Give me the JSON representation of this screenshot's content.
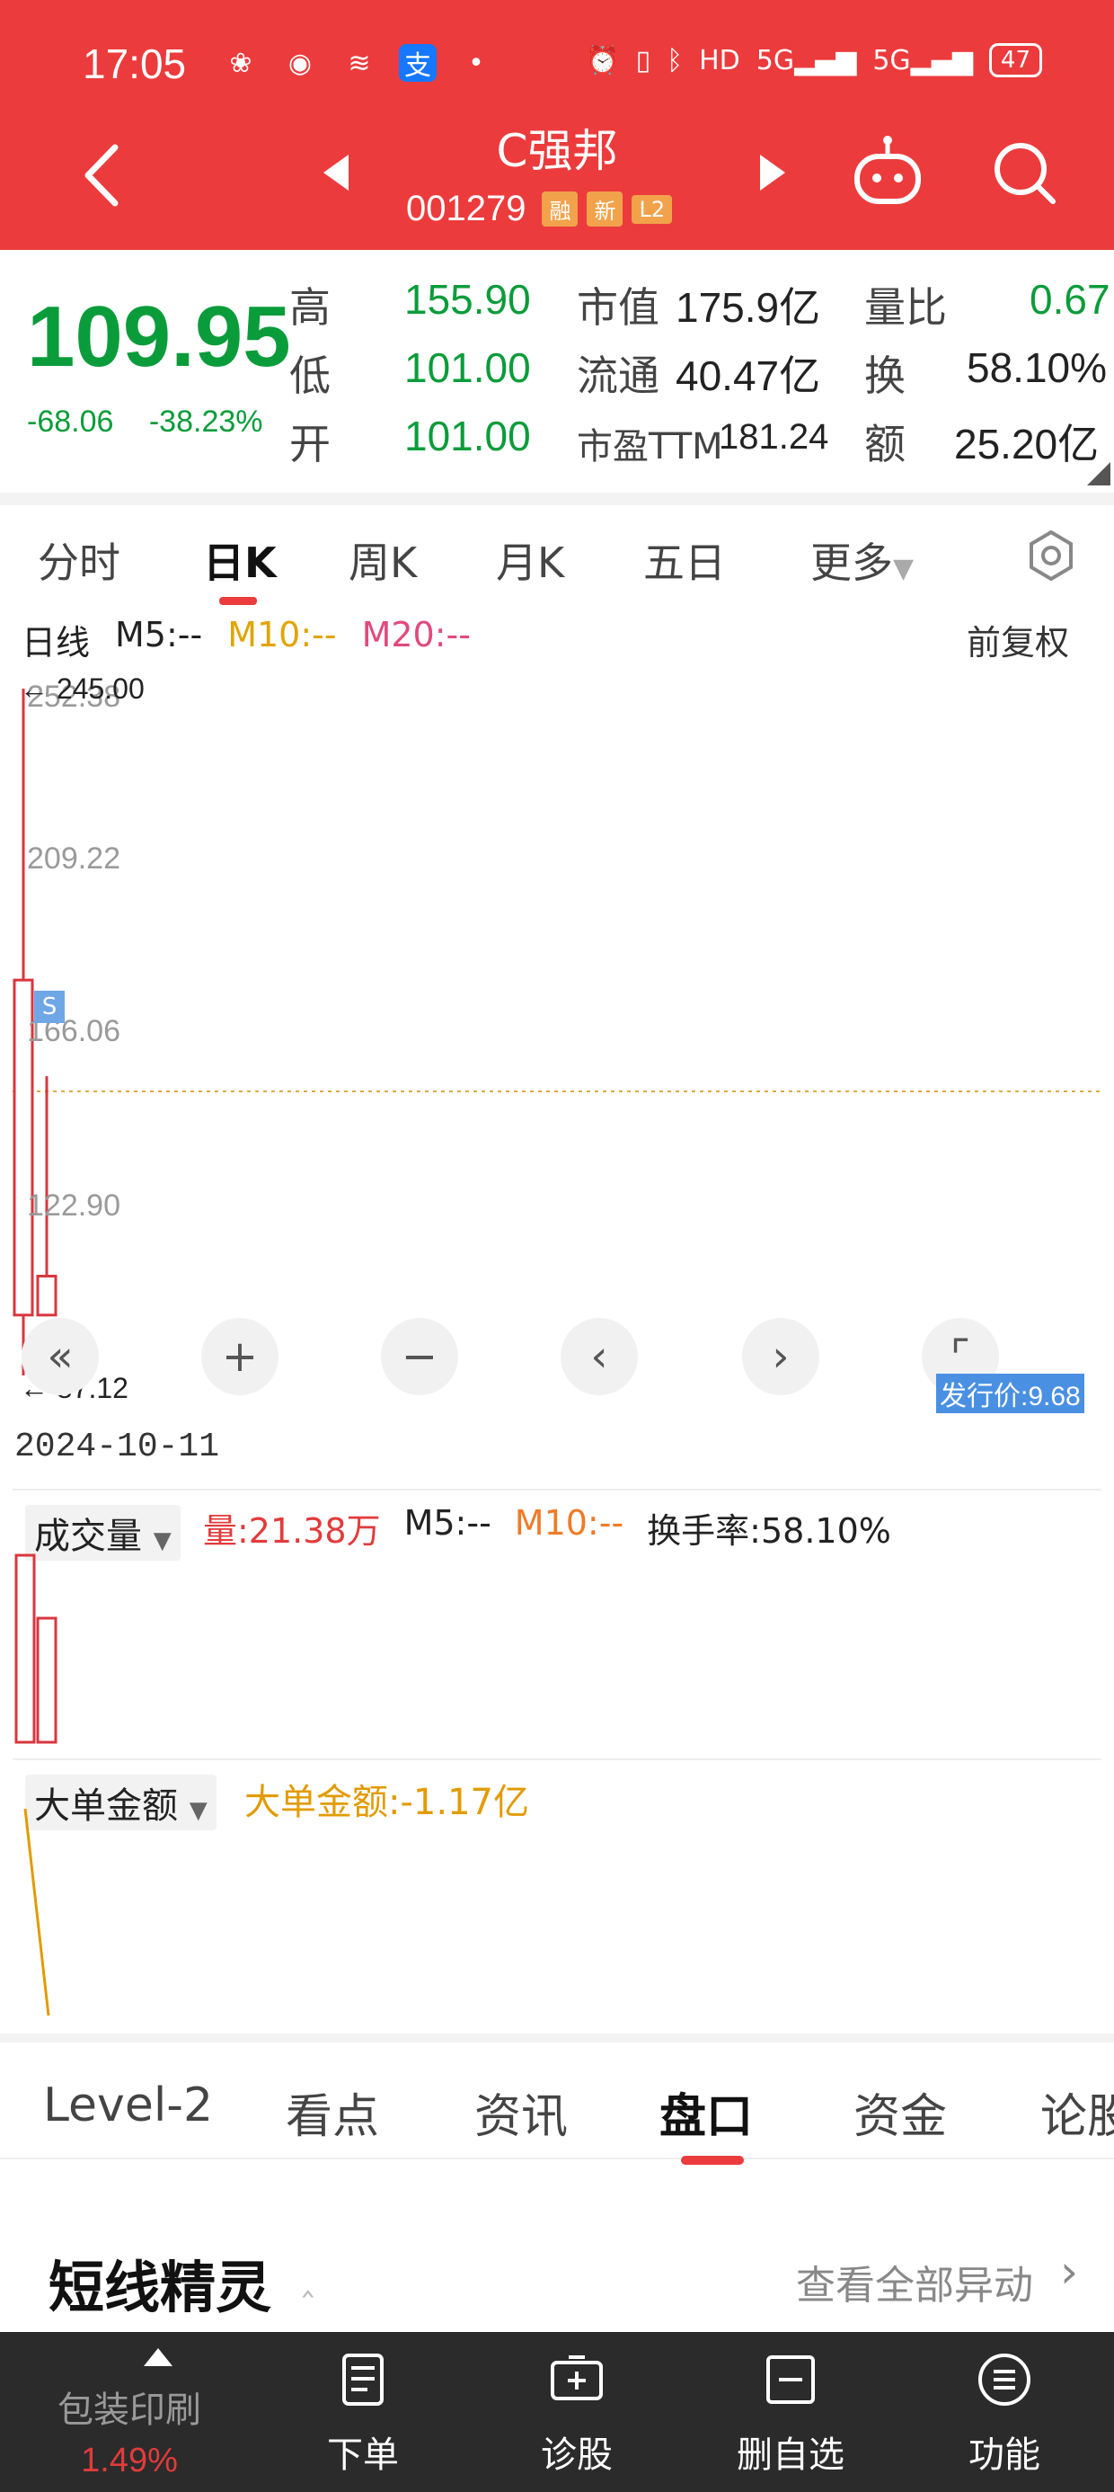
{
  "status": {
    "time": "17:05",
    "battery": "47"
  },
  "header": {
    "stock_name": "C强邦",
    "stock_code": "001279",
    "tags": [
      "融",
      "新",
      "L2"
    ]
  },
  "quote": {
    "price": "109.95",
    "change": "-68.06",
    "change_pct": "-38.23%",
    "high_label": "高",
    "high": "155.90",
    "low_label": "低",
    "low": "101.00",
    "open_label": "开",
    "open": "101.00",
    "mktcap_label": "市值",
    "mktcap": "175.9亿",
    "float_label": "流通",
    "float": "40.47亿",
    "pe_label": "市盈TTM",
    "pe": "181.24",
    "vr_label": "量比",
    "vr": "0.67",
    "turnover_label": "换",
    "turnover": "58.10%",
    "amount_label": "额",
    "amount": "25.20亿"
  },
  "tabs": {
    "items": [
      "分时",
      "日K",
      "周K",
      "月K",
      "五日",
      "更多"
    ],
    "active": "日K"
  },
  "kline": {
    "legend_title": "日线",
    "m5": "M5:--",
    "m10": "M10:--",
    "m20": "M20:--",
    "adjust": "前复权",
    "high_annot": "245.00",
    "low_annot": "87.12",
    "issue_price": "发行价:9.68",
    "s_marker": "S",
    "date": "2024-10-11"
  },
  "chart_data": {
    "type": "candlestick",
    "y_ticks": [
      "252.38",
      "209.22",
      "166.06",
      "122.90",
      "87.12"
    ],
    "candles": [
      {
        "open": 101.0,
        "close": 178.01,
        "high": 245.0,
        "low": 87.12
      },
      {
        "open": 101.0,
        "close": 109.95,
        "high": 155.9,
        "low": 101.0
      }
    ]
  },
  "volume": {
    "dropdown": "成交量",
    "vol": "量:21.38万",
    "m5": "M5:--",
    "m10": "M10:--",
    "turnover": "换手率:58.10%"
  },
  "bigorder": {
    "dropdown": "大单金额",
    "value": "大单金额:-1.17亿"
  },
  "bottom_tabs": {
    "items": [
      "Level-2",
      "看点",
      "资讯",
      "盘口",
      "资金",
      "论股"
    ],
    "active": "盘口"
  },
  "sprite": {
    "title": "短线精灵",
    "see_all": "查看全部异动"
  },
  "bottom_bar": {
    "sector": "包装印刷",
    "sector_pct": "1.49%",
    "items": [
      "下单",
      "诊股",
      "删自选",
      "功能"
    ]
  },
  "colors": {
    "header_red": "#ec3b3c",
    "down_green": "#0a9c3a",
    "candle_red": "#d9363e"
  }
}
